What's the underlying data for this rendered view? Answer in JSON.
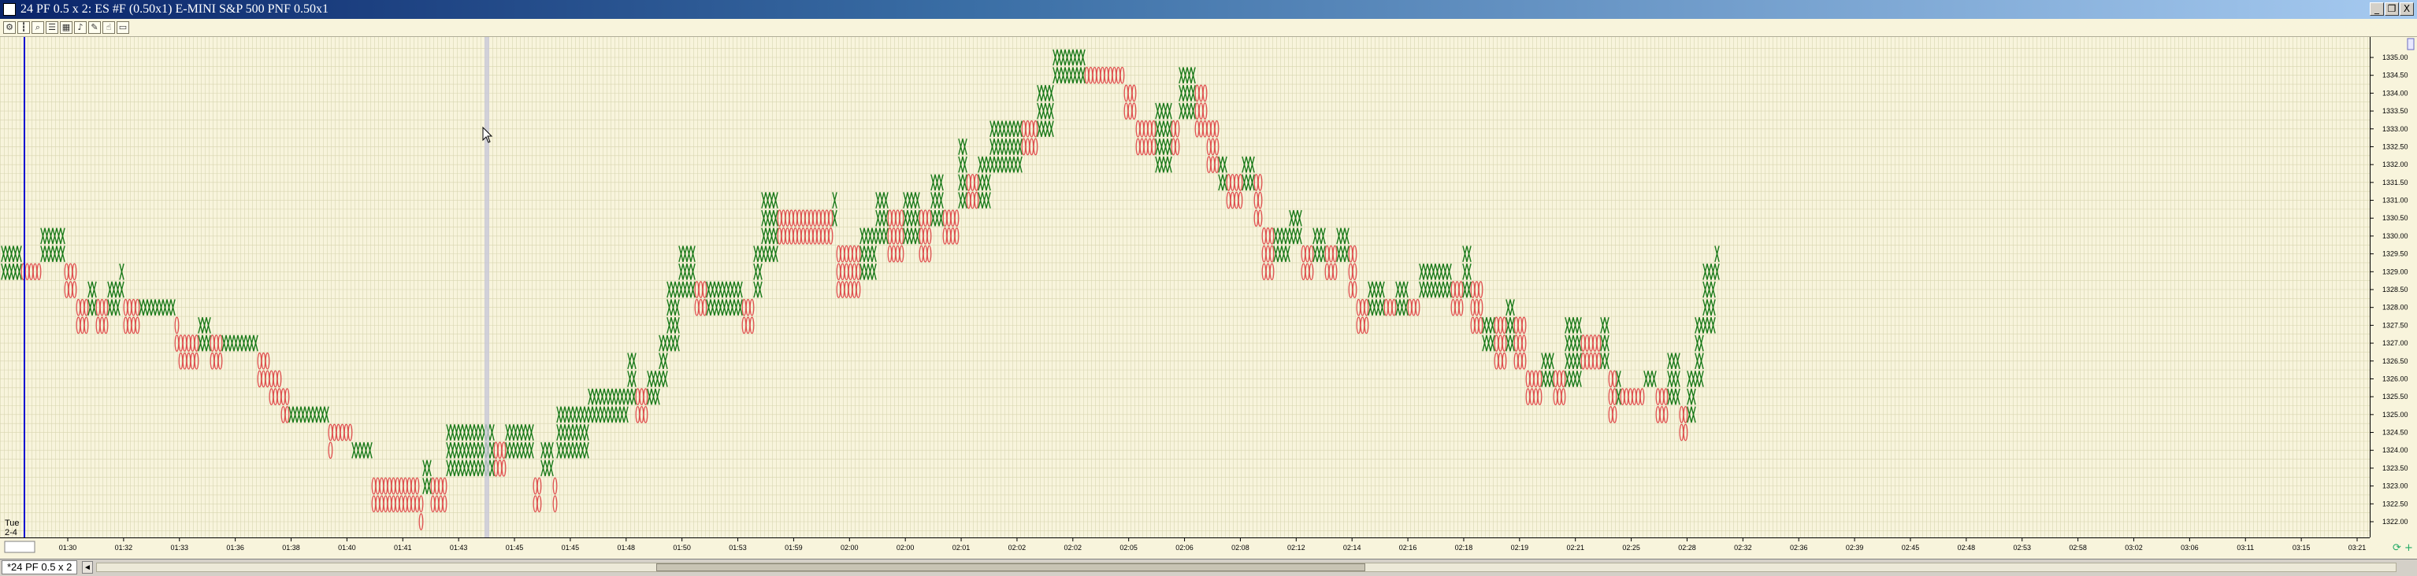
{
  "window": {
    "title": "24 PF 0.5 x 2: ES #F (0.50x1) E-MINI S&P 500 PNF 0.50x1",
    "minimize_label": "_",
    "restore_label": "❐",
    "close_label": "X"
  },
  "toolbar": {
    "icons": [
      "settings-icon",
      "bars-icon",
      "zoom-icon",
      "list-icon",
      "grid-icon",
      "bell-icon",
      "draw-icon",
      "pointer-icon",
      "rect-icon"
    ]
  },
  "tabs": {
    "active_label": "*24 PF 0.5 x 2",
    "scroll_left": "◄"
  },
  "day_label": {
    "line1": "Tue",
    "line2": "2-4"
  },
  "colors": {
    "background": "#f8f4dc",
    "grid": "#d8d5b0",
    "x_color": "#1a7a1a",
    "o_color": "#e05050",
    "cursor_line": "#0000d0",
    "crosshair": "#b0b0c8"
  },
  "chart_data": {
    "type": "point-and-figure",
    "title": "24 PF 0.5 x 2: ES #F (0.50x1) E-MINI S&P 500 PNF 0.50x1",
    "box_size": 0.5,
    "reversal": 2,
    "ylim": [
      1321.75,
      1335.25
    ],
    "y_ticks": [
      1322.0,
      1322.5,
      1323.0,
      1323.5,
      1324.0,
      1324.5,
      1325.0,
      1325.5,
      1326.0,
      1326.5,
      1327.0,
      1327.5,
      1328.0,
      1328.5,
      1329.0,
      1329.5,
      1330.0,
      1330.5,
      1331.0,
      1331.5,
      1332.0,
      1332.5,
      1333.0,
      1333.5,
      1334.0,
      1334.5,
      1335.0
    ],
    "x_ticks": [
      "01:30",
      "01:32",
      "01:33",
      "01:36",
      "01:38",
      "01:40",
      "01:41",
      "01:43",
      "01:45",
      "01:45",
      "01:48",
      "01:50",
      "01:53",
      "01:59",
      "02:00",
      "02:00",
      "02:01",
      "02:02",
      "02:02",
      "02:05",
      "02:06",
      "02:08",
      "02:12",
      "02:14",
      "02:16",
      "02:18",
      "02:19",
      "02:21",
      "02:25",
      "02:28",
      "02:32",
      "02:36",
      "02:39",
      "02:45",
      "02:48",
      "02:53",
      "02:58",
      "03:02",
      "03:06",
      "03:11",
      "03:15",
      "03:21"
    ],
    "columns": [
      {
        "type": "X",
        "low": 1329.0,
        "high": 1329.5,
        "count": 5
      },
      {
        "type": "O",
        "low": 1329.0,
        "high": 1329.0,
        "count": 5
      },
      {
        "type": "X",
        "low": 1329.5,
        "high": 1330.0,
        "count": 6
      },
      {
        "type": "O",
        "low": 1328.5,
        "high": 1329.0,
        "count": 3
      },
      {
        "type": "O",
        "low": 1327.5,
        "high": 1328.0,
        "count": 3
      },
      {
        "type": "X",
        "low": 1328.0,
        "high": 1328.5,
        "count": 2
      },
      {
        "type": "O",
        "low": 1327.5,
        "high": 1328.0,
        "count": 3
      },
      {
        "type": "X",
        "low": 1328.0,
        "high": 1328.5,
        "count": 3
      },
      {
        "type": "X",
        "low": 1328.5,
        "high": 1329.0,
        "count": 1
      },
      {
        "type": "O",
        "low": 1327.5,
        "high": 1328.0,
        "count": 4
      },
      {
        "type": "X",
        "low": 1328.0,
        "high": 1328.0,
        "count": 9
      },
      {
        "type": "O",
        "low": 1327.0,
        "high": 1327.5,
        "count": 1
      },
      {
        "type": "O",
        "low": 1326.5,
        "high": 1327.0,
        "count": 5
      },
      {
        "type": "X",
        "low": 1327.0,
        "high": 1327.5,
        "count": 3
      },
      {
        "type": "O",
        "low": 1326.5,
        "high": 1327.0,
        "count": 3
      },
      {
        "type": "X",
        "low": 1327.0,
        "high": 1327.0,
        "count": 9
      },
      {
        "type": "O",
        "low": 1326.0,
        "high": 1326.5,
        "count": 3
      },
      {
        "type": "O",
        "low": 1325.5,
        "high": 1326.0,
        "count": 3
      },
      {
        "type": "O",
        "low": 1325.0,
        "high": 1325.5,
        "count": 2
      },
      {
        "type": "X",
        "low": 1325.0,
        "high": 1325.0,
        "count": 10
      },
      {
        "type": "O",
        "low": 1324.0,
        "high": 1324.5,
        "count": 1
      },
      {
        "type": "O",
        "low": 1324.5,
        "high": 1324.5,
        "count": 5
      },
      {
        "type": "X",
        "low": 1324.0,
        "high": 1324.0,
        "count": 5
      },
      {
        "type": "O",
        "low": 1322.5,
        "high": 1323.0,
        "count": 12
      },
      {
        "type": "O",
        "low": 1322.0,
        "high": 1322.5,
        "count": 1
      },
      {
        "type": "X",
        "low": 1323.0,
        "high": 1323.5,
        "count": 2
      },
      {
        "type": "O",
        "low": 1322.5,
        "high": 1323.0,
        "count": 4
      },
      {
        "type": "X",
        "low": 1323.5,
        "high": 1324.5,
        "count": 12
      },
      {
        "type": "O",
        "low": 1323.5,
        "high": 1324.0,
        "count": 3
      },
      {
        "type": "X",
        "low": 1324.0,
        "high": 1324.5,
        "count": 7
      },
      {
        "type": "O",
        "low": 1322.5,
        "high": 1323.0,
        "count": 2
      },
      {
        "type": "X",
        "low": 1323.5,
        "high": 1324.0,
        "count": 3
      },
      {
        "type": "O",
        "low": 1322.5,
        "high": 1323.0,
        "count": 1
      },
      {
        "type": "X",
        "low": 1324.0,
        "high": 1325.0,
        "count": 8
      },
      {
        "type": "X",
        "low": 1325.0,
        "high": 1325.5,
        "count": 10
      },
      {
        "type": "X",
        "low": 1325.5,
        "high": 1326.5,
        "count": 2
      },
      {
        "type": "O",
        "low": 1325.0,
        "high": 1325.5,
        "count": 3
      },
      {
        "type": "X",
        "low": 1325.5,
        "high": 1326.0,
        "count": 3
      },
      {
        "type": "X",
        "low": 1326.0,
        "high": 1327.0,
        "count": 2
      },
      {
        "type": "X",
        "low": 1327.0,
        "high": 1328.5,
        "count": 3
      },
      {
        "type": "X",
        "low": 1328.5,
        "high": 1329.5,
        "count": 4
      },
      {
        "type": "O",
        "low": 1328.0,
        "high": 1328.5,
        "count": 3
      },
      {
        "type": "X",
        "low": 1328.0,
        "high": 1328.5,
        "count": 9
      },
      {
        "type": "O",
        "low": 1327.5,
        "high": 1328.0,
        "count": 3
      },
      {
        "type": "X",
        "low": 1328.5,
        "high": 1329.5,
        "count": 2
      },
      {
        "type": "X",
        "low": 1329.5,
        "high": 1331.0,
        "count": 4
      },
      {
        "type": "O",
        "low": 1330.0,
        "high": 1330.5,
        "count": 14
      },
      {
        "type": "X",
        "low": 1330.5,
        "high": 1331.0,
        "count": 1
      },
      {
        "type": "O",
        "low": 1328.5,
        "high": 1329.5,
        "count": 6
      },
      {
        "type": "X",
        "low": 1329.0,
        "high": 1330.0,
        "count": 4
      },
      {
        "type": "X",
        "low": 1330.0,
        "high": 1331.0,
        "count": 3
      },
      {
        "type": "O",
        "low": 1329.5,
        "high": 1330.5,
        "count": 4
      },
      {
        "type": "X",
        "low": 1330.0,
        "high": 1331.0,
        "count": 4
      },
      {
        "type": "O",
        "low": 1329.5,
        "high": 1330.5,
        "count": 3
      },
      {
        "type": "X",
        "low": 1330.5,
        "high": 1331.5,
        "count": 3
      },
      {
        "type": "O",
        "low": 1330.0,
        "high": 1330.5,
        "count": 4
      },
      {
        "type": "X",
        "low": 1331.0,
        "high": 1332.5,
        "count": 2
      },
      {
        "type": "O",
        "low": 1331.0,
        "high": 1331.5,
        "count": 3
      },
      {
        "type": "X",
        "low": 1331.0,
        "high": 1332.0,
        "count": 3
      },
      {
        "type": "X",
        "low": 1332.0,
        "high": 1333.0,
        "count": 8
      },
      {
        "type": "O",
        "low": 1332.5,
        "high": 1333.0,
        "count": 4
      },
      {
        "type": "X",
        "low": 1333.0,
        "high": 1334.0,
        "count": 4
      },
      {
        "type": "X",
        "low": 1334.5,
        "high": 1335.0,
        "count": 8
      },
      {
        "type": "O",
        "low": 1334.5,
        "high": 1334.5,
        "count": 10
      },
      {
        "type": "O",
        "low": 1333.5,
        "high": 1334.0,
        "count": 3
      },
      {
        "type": "O",
        "low": 1332.5,
        "high": 1333.0,
        "count": 5
      },
      {
        "type": "X",
        "low": 1332.0,
        "high": 1333.5,
        "count": 4
      },
      {
        "type": "O",
        "low": 1332.5,
        "high": 1333.0,
        "count": 2
      },
      {
        "type": "X",
        "low": 1333.5,
        "high": 1334.5,
        "count": 4
      },
      {
        "type": "O",
        "low": 1333.0,
        "high": 1334.0,
        "count": 3
      },
      {
        "type": "O",
        "low": 1332.0,
        "high": 1333.0,
        "count": 3
      },
      {
        "type": "X",
        "low": 1331.5,
        "high": 1332.0,
        "count": 2
      },
      {
        "type": "O",
        "low": 1331.0,
        "high": 1331.5,
        "count": 4
      },
      {
        "type": "X",
        "low": 1331.5,
        "high": 1332.0,
        "count": 3
      },
      {
        "type": "O",
        "low": 1330.5,
        "high": 1331.5,
        "count": 2
      },
      {
        "type": "O",
        "low": 1329.0,
        "high": 1330.0,
        "count": 3
      },
      {
        "type": "X",
        "low": 1329.5,
        "high": 1330.0,
        "count": 4
      },
      {
        "type": "X",
        "low": 1330.0,
        "high": 1330.5,
        "count": 3
      },
      {
        "type": "O",
        "low": 1329.0,
        "high": 1329.5,
        "count": 3
      },
      {
        "type": "X",
        "low": 1329.5,
        "high": 1330.0,
        "count": 3
      },
      {
        "type": "O",
        "low": 1329.0,
        "high": 1329.5,
        "count": 3
      },
      {
        "type": "X",
        "low": 1329.5,
        "high": 1330.0,
        "count": 3
      },
      {
        "type": "O",
        "low": 1328.5,
        "high": 1329.5,
        "count": 2
      },
      {
        "type": "O",
        "low": 1327.5,
        "high": 1328.0,
        "count": 3
      },
      {
        "type": "X",
        "low": 1328.0,
        "high": 1328.5,
        "count": 4
      },
      {
        "type": "O",
        "low": 1328.0,
        "high": 1328.0,
        "count": 3
      },
      {
        "type": "X",
        "low": 1328.0,
        "high": 1328.5,
        "count": 3
      },
      {
        "type": "O",
        "low": 1328.0,
        "high": 1328.0,
        "count": 3
      },
      {
        "type": "X",
        "low": 1328.5,
        "high": 1329.0,
        "count": 8
      },
      {
        "type": "O",
        "low": 1328.0,
        "high": 1328.5,
        "count": 3
      },
      {
        "type": "X",
        "low": 1328.5,
        "high": 1329.5,
        "count": 2
      },
      {
        "type": "O",
        "low": 1327.5,
        "high": 1328.5,
        "count": 3
      },
      {
        "type": "X",
        "low": 1327.0,
        "high": 1327.5,
        "count": 3
      },
      {
        "type": "O",
        "low": 1326.5,
        "high": 1327.5,
        "count": 3
      },
      {
        "type": "X",
        "low": 1327.0,
        "high": 1328.0,
        "count": 2
      },
      {
        "type": "O",
        "low": 1326.5,
        "high": 1327.5,
        "count": 3
      },
      {
        "type": "O",
        "low": 1325.5,
        "high": 1326.0,
        "count": 4
      },
      {
        "type": "X",
        "low": 1326.0,
        "high": 1326.5,
        "count": 3
      },
      {
        "type": "O",
        "low": 1325.5,
        "high": 1326.0,
        "count": 3
      },
      {
        "type": "X",
        "low": 1326.0,
        "high": 1327.5,
        "count": 4
      },
      {
        "type": "O",
        "low": 1326.5,
        "high": 1327.0,
        "count": 5
      },
      {
        "type": "X",
        "low": 1326.5,
        "high": 1327.5,
        "count": 2
      },
      {
        "type": "O",
        "low": 1325.0,
        "high": 1326.0,
        "count": 2
      },
      {
        "type": "X",
        "low": 1325.5,
        "high": 1326.0,
        "count": 1
      },
      {
        "type": "O",
        "low": 1325.5,
        "high": 1325.5,
        "count": 6
      },
      {
        "type": "X",
        "low": 1326.0,
        "high": 1326.0,
        "count": 3
      },
      {
        "type": "O",
        "low": 1325.0,
        "high": 1325.5,
        "count": 3
      },
      {
        "type": "X",
        "low": 1325.5,
        "high": 1326.5,
        "count": 3
      },
      {
        "type": "O",
        "low": 1324.5,
        "high": 1325.0,
        "count": 2
      },
      {
        "type": "X",
        "low": 1325.0,
        "high": 1326.0,
        "count": 2
      },
      {
        "type": "X",
        "low": 1326.0,
        "high": 1327.5,
        "count": 2
      },
      {
        "type": "X",
        "low": 1327.5,
        "high": 1329.0,
        "count": 3
      },
      {
        "type": "X",
        "low": 1329.0,
        "high": 1329.5,
        "count": 1
      }
    ]
  }
}
